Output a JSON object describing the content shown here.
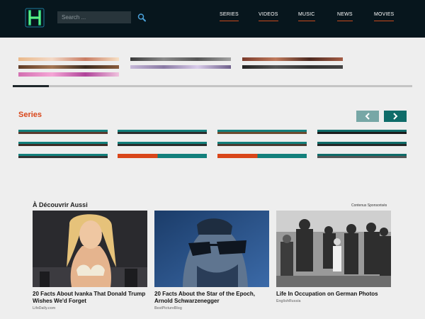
{
  "header": {
    "search_placeholder": "Search ...",
    "nav": [
      {
        "label": "SERIES"
      },
      {
        "label": "VIDEOS"
      },
      {
        "label": "MUSIC"
      },
      {
        "label": "NEWS"
      },
      {
        "label": "MOVIES"
      }
    ],
    "colors": {
      "background": "#07161d",
      "nav_underline": "#c8491e",
      "logo": "#27e08a"
    }
  },
  "carousel": {
    "progress": 0.09
  },
  "series": {
    "title": "Series",
    "prev_icon": "chevron-left-icon",
    "next_icon": "chevron-right-icon",
    "colors": {
      "title": "#d9461a",
      "prev": "#77a7a6",
      "next": "#0f6c69"
    }
  },
  "sponsored": {
    "title": "À Découvrir Aussi",
    "label": "Contenus Sponsorisés",
    "cards": [
      {
        "title": "20 Facts About Ivanka That Donald Trump Wishes We'd Forget",
        "source": "LifeDaily.com"
      },
      {
        "title": "20 Facts About the Star of the Epoch, Arnold Schwarzenegger",
        "source": "BestPictureBlog"
      },
      {
        "title": "Life In Occupation on German Photos",
        "source": "EnglishRussia"
      }
    ]
  }
}
